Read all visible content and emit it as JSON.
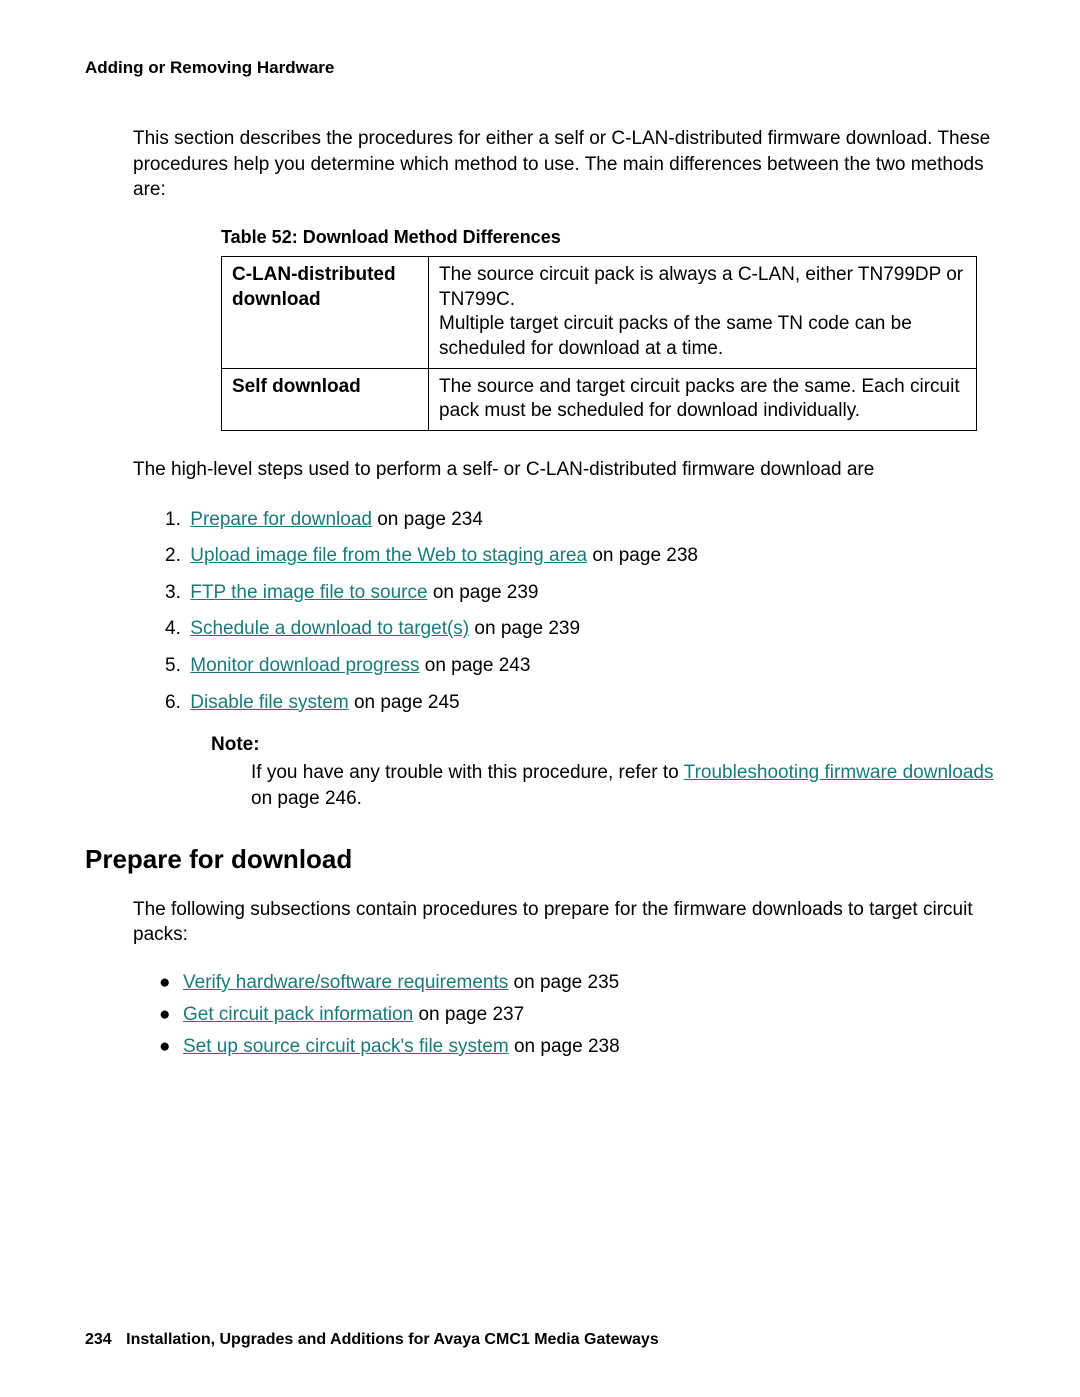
{
  "header": "Adding or Removing Hardware",
  "intro": "This section describes the procedures for either a self or C-LAN-distributed firmware download. These procedures help you determine which method to use. The main differences between the two methods are:",
  "table": {
    "caption": "Table 52: Download Method Differences",
    "rows": [
      {
        "label": "C-LAN-distributed download",
        "desc": "The source circuit pack is always a C-LAN, either TN799DP or TN799C.\nMultiple target circuit packs of the same TN code can be scheduled for download at a time."
      },
      {
        "label": "Self download",
        "desc": "The source and target circuit packs are the same. Each circuit pack must be scheduled for download individually."
      }
    ]
  },
  "steps_intro": "The high-level steps used to perform a self- or C-LAN-distributed firmware download are",
  "steps": [
    {
      "num": "1.",
      "link": "Prepare for download",
      "suffix": " on page 234"
    },
    {
      "num": "2.",
      "link": "Upload image file from the Web to staging area",
      "suffix": " on page 238"
    },
    {
      "num": "3.",
      "link": "FTP the image file to source",
      "suffix": " on page 239"
    },
    {
      "num": "4.",
      "link": "Schedule a download to target(s)",
      "suffix": " on page 239"
    },
    {
      "num": "5.",
      "link": "Monitor download progress",
      "suffix": " on page 243"
    },
    {
      "num": "6.",
      "link": "Disable file system",
      "suffix": " on page 245"
    }
  ],
  "note": {
    "label": "Note:",
    "prefix": "If you have any trouble with this procedure, refer to ",
    "link": "Troubleshooting firmware downloads",
    "suffix": " on page 246."
  },
  "section_heading": "Prepare for download",
  "section_intro": "The following subsections contain procedures to prepare for the firmware downloads to target circuit packs:",
  "bullets": [
    {
      "link": "Verify hardware/software requirements",
      "suffix": " on page 235"
    },
    {
      "link": "Get circuit pack information",
      "suffix": " on page 237"
    },
    {
      "link": "Set up source circuit pack's file system",
      "suffix": " on page 238"
    }
  ],
  "footer": {
    "page": "234",
    "title": "Installation, Upgrades and Additions for Avaya CMC1 Media Gateways"
  }
}
